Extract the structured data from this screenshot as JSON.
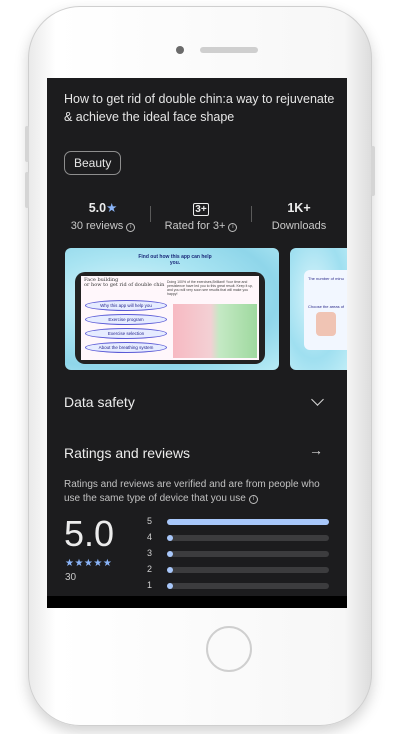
{
  "app": {
    "title": "How to get rid of double chin:a way to rejuvenate & achieve the ideal face shape",
    "category_chip": "Beauty"
  },
  "stats": {
    "rating_value": "5.0",
    "rating_star": "★",
    "reviews_label": "30 reviews",
    "content_rating_badge": "3+",
    "content_rating_label": "Rated for 3+",
    "downloads_value": "1K+",
    "downloads_label": "Downloads",
    "info_glyph": "i"
  },
  "screenshots": {
    "shot1": {
      "header": "Find out how this app can help you.",
      "menu_title": "Face building\nor how to get rid of double chin",
      "menu_items": [
        "Why this app will help you",
        "Exercise program",
        "Exercise selection",
        "About the breathing system"
      ],
      "blurb": "Doing 100% of the exercises,Brilliant! Your time and persistence have led you to this great result. Keep it up, and you will very soon see results that will make you happy!"
    },
    "shot2": {
      "line1": "The number of minu",
      "line2": "Choose the areas of"
    }
  },
  "sections": {
    "data_safety": "Data safety",
    "ratings_reviews": "Ratings and reviews",
    "ratings_desc": "Ratings and reviews are verified and are from people who use the same type of device that you use"
  },
  "rating_summary": {
    "average": "5.0",
    "stars": "★★★★★",
    "count": "30",
    "distribution": [
      {
        "label": "5",
        "fraction": 1.0
      },
      {
        "label": "4",
        "fraction": 0.04
      },
      {
        "label": "3",
        "fraction": 0.04
      },
      {
        "label": "2",
        "fraction": 0.04
      },
      {
        "label": "1",
        "fraction": 0.04
      }
    ]
  },
  "colors": {
    "accent_blue": "#8ab4f8",
    "bar_fill": "#a8c7fa",
    "background": "#1c1c1e"
  },
  "icons": {
    "data_safety_expand": "chevron-down-icon",
    "ratings_open": "arrow-right-icon"
  }
}
